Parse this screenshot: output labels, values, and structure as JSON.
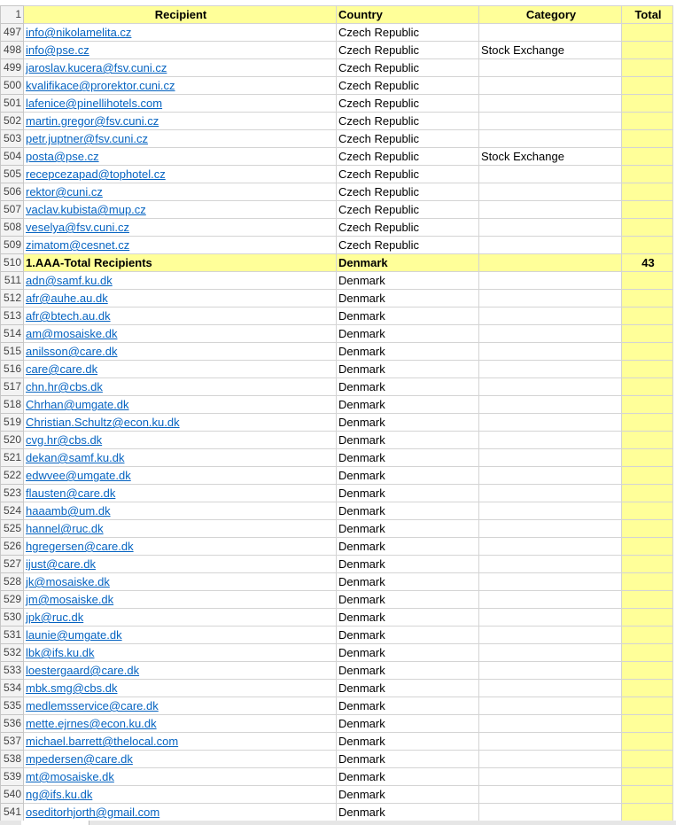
{
  "headers": {
    "row_number": "1",
    "recipient": "Recipient",
    "country": "Country",
    "category": "Category",
    "total": "Total"
  },
  "colors": {
    "header_fill": "#ffff99",
    "link": "#0563c1",
    "grid": "#d4d4d4"
  },
  "rows": [
    {
      "n": "497",
      "recipient": "info@nikolamelita.cz",
      "country": "Czech Republic",
      "category": "",
      "total": ""
    },
    {
      "n": "498",
      "recipient": "info@pse.cz",
      "country": "Czech Republic",
      "category": "Stock Exchange",
      "total": ""
    },
    {
      "n": "499",
      "recipient": "jaroslav.kucera@fsv.cuni.cz",
      "country": "Czech Republic",
      "category": "",
      "total": ""
    },
    {
      "n": "500",
      "recipient": "kvalifikace@prorektor.cuni.cz",
      "country": "Czech Republic",
      "category": "",
      "total": ""
    },
    {
      "n": "501",
      "recipient": "lafenice@pinellihotels.com",
      "country": "Czech Republic",
      "category": "",
      "total": ""
    },
    {
      "n": "502",
      "recipient": "martin.gregor@fsv.cuni.cz",
      "country": "Czech Republic",
      "category": "",
      "total": ""
    },
    {
      "n": "503",
      "recipient": "petr.juptner@fsv.cuni.cz",
      "country": "Czech Republic",
      "category": "",
      "total": ""
    },
    {
      "n": "504",
      "recipient": "posta@pse.cz",
      "country": "Czech Republic",
      "category": "Stock Exchange",
      "total": ""
    },
    {
      "n": "505",
      "recipient": "recepcezapad@tophotel.cz",
      "country": "Czech Republic",
      "category": "",
      "total": ""
    },
    {
      "n": "506",
      "recipient": "rektor@cuni.cz",
      "country": "Czech Republic",
      "category": "",
      "total": ""
    },
    {
      "n": "507",
      "recipient": "vaclav.kubista@mup.cz",
      "country": "Czech Republic",
      "category": "",
      "total": ""
    },
    {
      "n": "508",
      "recipient": "veselya@fsv.cuni.cz",
      "country": "Czech Republic",
      "category": "",
      "total": ""
    },
    {
      "n": "509",
      "recipient": "zimatom@cesnet.cz",
      "country": "Czech Republic",
      "category": "",
      "total": ""
    },
    {
      "n": "510",
      "recipient": "1.AAA-Total Recipients",
      "country": "Denmark",
      "category": "",
      "total": "43",
      "is_total": true
    },
    {
      "n": "511",
      "recipient": "adn@samf.ku.dk",
      "country": "Denmark",
      "category": "",
      "total": ""
    },
    {
      "n": "512",
      "recipient": "afr@auhe.au.dk",
      "country": "Denmark",
      "category": "",
      "total": ""
    },
    {
      "n": "513",
      "recipient": "afr@btech.au.dk",
      "country": "Denmark",
      "category": "",
      "total": ""
    },
    {
      "n": "514",
      "recipient": "am@mosaiske.dk",
      "country": "Denmark",
      "category": "",
      "total": ""
    },
    {
      "n": "515",
      "recipient": "anilsson@care.dk",
      "country": "Denmark",
      "category": "",
      "total": ""
    },
    {
      "n": "516",
      "recipient": "care@care.dk",
      "country": "Denmark",
      "category": "",
      "total": ""
    },
    {
      "n": "517",
      "recipient": "chn.hr@cbs.dk",
      "country": "Denmark",
      "category": "",
      "total": ""
    },
    {
      "n": "518",
      "recipient": "Chrhan@umgate.dk",
      "country": "Denmark",
      "category": "",
      "total": ""
    },
    {
      "n": "519",
      "recipient": "Christian.Schultz@econ.ku.dk",
      "country": "Denmark",
      "category": "",
      "total": ""
    },
    {
      "n": "520",
      "recipient": "cvg.hr@cbs.dk",
      "country": "Denmark",
      "category": "",
      "total": ""
    },
    {
      "n": "521",
      "recipient": "dekan@samf.ku.dk",
      "country": "Denmark",
      "category": "",
      "total": ""
    },
    {
      "n": "522",
      "recipient": "edwvee@umgate.dk",
      "country": "Denmark",
      "category": "",
      "total": ""
    },
    {
      "n": "523",
      "recipient": "flausten@care.dk",
      "country": "Denmark",
      "category": "",
      "total": ""
    },
    {
      "n": "524",
      "recipient": "haaamb@um.dk",
      "country": "Denmark",
      "category": "",
      "total": ""
    },
    {
      "n": "525",
      "recipient": "hannel@ruc.dk",
      "country": "Denmark",
      "category": "",
      "total": ""
    },
    {
      "n": "526",
      "recipient": "hgregersen@care.dk",
      "country": "Denmark",
      "category": "",
      "total": ""
    },
    {
      "n": "527",
      "recipient": "ijust@care.dk",
      "country": "Denmark",
      "category": "",
      "total": ""
    },
    {
      "n": "528",
      "recipient": "jk@mosaiske.dk",
      "country": "Denmark",
      "category": "",
      "total": ""
    },
    {
      "n": "529",
      "recipient": "jm@mosaiske.dk",
      "country": "Denmark",
      "category": "",
      "total": ""
    },
    {
      "n": "530",
      "recipient": "jpk@ruc.dk",
      "country": "Denmark",
      "category": "",
      "total": ""
    },
    {
      "n": "531",
      "recipient": "launie@umgate.dk",
      "country": "Denmark",
      "category": "",
      "total": ""
    },
    {
      "n": "532",
      "recipient": "lbk@ifs.ku.dk",
      "country": "Denmark",
      "category": "",
      "total": ""
    },
    {
      "n": "533",
      "recipient": "loestergaard@care.dk",
      "country": "Denmark",
      "category": "",
      "total": ""
    },
    {
      "n": "534",
      "recipient": "mbk.smg@cbs.dk",
      "country": "Denmark",
      "category": "",
      "total": ""
    },
    {
      "n": "535",
      "recipient": "medlemsservice@care.dk",
      "country": "Denmark",
      "category": "",
      "total": ""
    },
    {
      "n": "536",
      "recipient": "mette.ejrnes@econ.ku.dk",
      "country": "Denmark",
      "category": "",
      "total": ""
    },
    {
      "n": "537",
      "recipient": "michael.barrett@thelocal.com",
      "country": "Denmark",
      "category": "",
      "total": ""
    },
    {
      "n": "538",
      "recipient": "mpedersen@care.dk",
      "country": "Denmark",
      "category": "",
      "total": ""
    },
    {
      "n": "539",
      "recipient": "mt@mosaiske.dk",
      "country": "Denmark",
      "category": "",
      "total": ""
    },
    {
      "n": "540",
      "recipient": "ng@ifs.ku.dk",
      "country": "Denmark",
      "category": "",
      "total": ""
    },
    {
      "n": "541",
      "recipient": "oseditorhjorth@gmail.com",
      "country": "Denmark",
      "category": "",
      "total": ""
    }
  ]
}
